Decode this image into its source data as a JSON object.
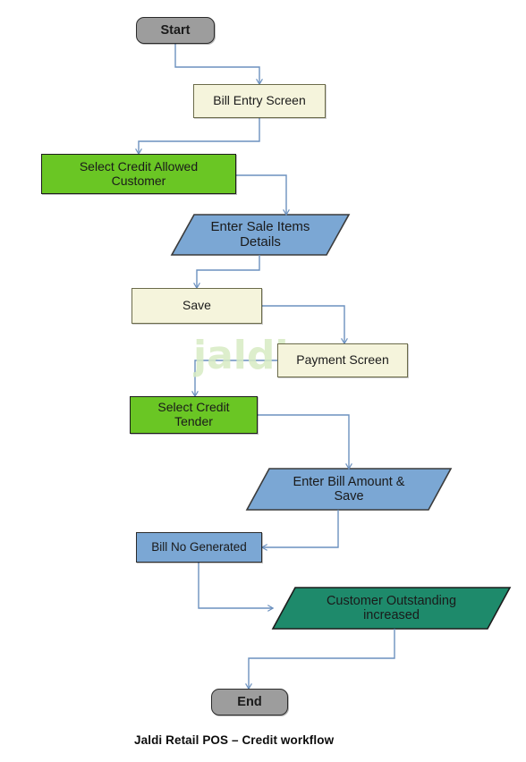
{
  "diagram": {
    "caption": "Jaldi Retail POS – Credit workflow",
    "watermark": "jaldi",
    "colors": {
      "terminator": "#9d9d9d",
      "process_cream": "#f5f4dc",
      "action_green": "#6ac624",
      "io_blue": "#7ba7d4",
      "result_teal": "#1e8a6b",
      "connector": "#6c91bf",
      "watermark": "#d8ecc4"
    },
    "nodes": [
      {
        "id": "start",
        "label": "Start",
        "shape": "terminator"
      },
      {
        "id": "bill_entry",
        "label": "Bill Entry Screen",
        "shape": "process"
      },
      {
        "id": "sel_customer",
        "label": "Select Credit Allowed\nCustomer",
        "shape": "action"
      },
      {
        "id": "sale_items",
        "label": "Enter Sale Items\nDetails",
        "shape": "io"
      },
      {
        "id": "save",
        "label": "Save",
        "shape": "process"
      },
      {
        "id": "payment",
        "label": "Payment Screen",
        "shape": "process"
      },
      {
        "id": "sel_tender",
        "label": "Select Credit\nTender",
        "shape": "action"
      },
      {
        "id": "bill_amount",
        "label": "Enter Bill Amount &\nSave",
        "shape": "io"
      },
      {
        "id": "bill_no",
        "label": "Bill No Generated",
        "shape": "data"
      },
      {
        "id": "outstanding",
        "label": "Customer Outstanding\nincreased",
        "shape": "result"
      },
      {
        "id": "end",
        "label": "End",
        "shape": "terminator"
      }
    ],
    "edges": [
      {
        "from": "start",
        "to": "bill_entry"
      },
      {
        "from": "bill_entry",
        "to": "sel_customer"
      },
      {
        "from": "sel_customer",
        "to": "sale_items"
      },
      {
        "from": "sale_items",
        "to": "save"
      },
      {
        "from": "save",
        "to": "payment"
      },
      {
        "from": "payment",
        "to": "sel_tender"
      },
      {
        "from": "sel_tender",
        "to": "bill_amount"
      },
      {
        "from": "bill_amount",
        "to": "bill_no"
      },
      {
        "from": "bill_no",
        "to": "outstanding"
      },
      {
        "from": "outstanding",
        "to": "end"
      }
    ]
  }
}
